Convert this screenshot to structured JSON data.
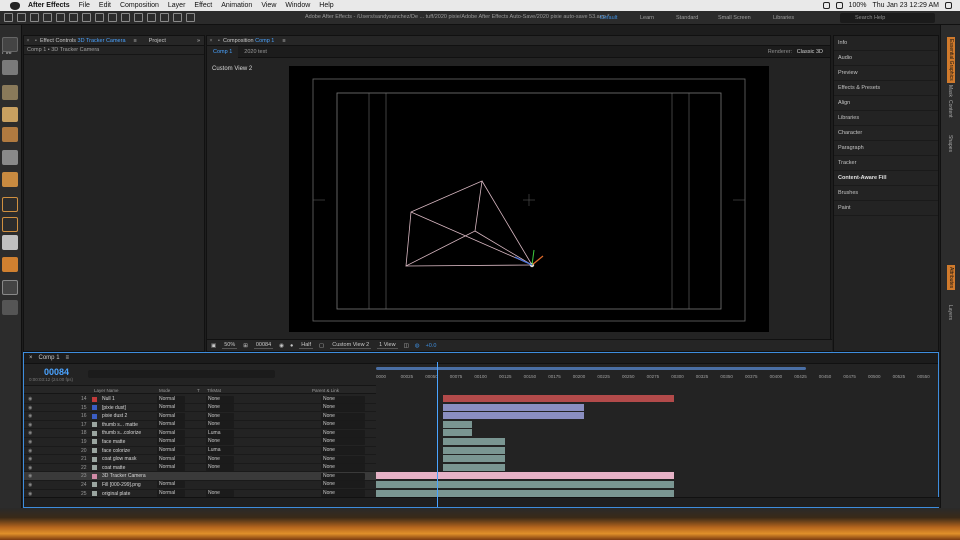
{
  "menubar": {
    "app": "After Effects",
    "items": [
      "File",
      "Edit",
      "Composition",
      "Layer",
      "Effect",
      "Animation",
      "View",
      "Window",
      "Help"
    ],
    "battery": "100%",
    "clock": "Thu Jan 23  12:29 AM"
  },
  "titlebar": {
    "path": "Adobe After Effects - /Users/sandysanchez/De ... tuff/2020 pixie/Adobe After Effects Auto-Save/2020 pixie auto-save 53.aep *",
    "workspaces": [
      "Default",
      "Learn",
      "Standard",
      "Small Screen",
      "Libraries"
    ],
    "search": "Search Help"
  },
  "left": {
    "file_tab": "File"
  },
  "effects_panel": {
    "tab": "Effect Controls",
    "tab_target": "3D Tracker Camera",
    "project_tab": "Project",
    "subhead": "Comp 1 • 3D Tracker Camera"
  },
  "composition_panel": {
    "tab": "Composition",
    "tab_target": "Comp 1",
    "subtabs": [
      "Comp 1",
      "2020 text"
    ],
    "renderer_label": "Renderer:",
    "renderer": "Classic 3D",
    "view_label": "Custom View 2",
    "bottom": {
      "zoom": "50%",
      "frame": "00084",
      "resolution": "Half",
      "view": "Custom View 2",
      "views": "1 View",
      "exposure": "+0.0"
    }
  },
  "right_panel": {
    "items": [
      "Info",
      "Audio",
      "Preview",
      "Effects & Presets",
      "Align",
      "Libraries",
      "Character",
      "Paragraph",
      "Tracker",
      "Content-Aware Fill",
      "Brushes",
      "Paint"
    ]
  },
  "right_strip": [
    "Essential Graphics",
    "Mask",
    "Content",
    "Shapes",
    "Attributes",
    "Layers"
  ],
  "timeline": {
    "tab": "Comp 1",
    "timecode": "00084",
    "timecode_sub": "0:00:03:12 (24.00 fps)",
    "columns": {
      "layer_name": "Layer Name",
      "mode": "Mode",
      "t": "T",
      "trkmat": "TrkMat",
      "parent": "Parent & Link"
    },
    "ruler": [
      "0000",
      "00025",
      "00050",
      "00075",
      "00100",
      "00125",
      "00150",
      "00175",
      "00200",
      "00225",
      "00250",
      "00275",
      "00300",
      "00325",
      "00350",
      "00375",
      "00400",
      "00425",
      "00450",
      "00475",
      "00500",
      "00525",
      "00550"
    ],
    "layers": [
      {
        "num": "14",
        "name": "Null 1",
        "color": "#c23b3b",
        "mode": "Normal",
        "trk": "None",
        "parent": "None"
      },
      {
        "num": "15",
        "name": "[pixie dust]",
        "color": "#3b5dc2",
        "mode": "Normal",
        "trk": "None",
        "parent": "None"
      },
      {
        "num": "16",
        "name": "pixie dust 2",
        "color": "#3b5dc2",
        "mode": "Normal",
        "trk": "None",
        "parent": "None"
      },
      {
        "num": "17",
        "name": "thumb s... matte",
        "color": "#9aa5a0",
        "mode": "Normal",
        "trk": "None",
        "parent": "None"
      },
      {
        "num": "18",
        "name": "thumb s...colorize",
        "color": "#9aa5a0",
        "mode": "Normal",
        "trk": "Luma",
        "parent": "None"
      },
      {
        "num": "19",
        "name": "face matte",
        "color": "#9aa5a0",
        "mode": "Normal",
        "trk": "None",
        "parent": "None"
      },
      {
        "num": "20",
        "name": "face colorize",
        "color": "#9aa5a0",
        "mode": "Normal",
        "trk": "Luma",
        "parent": "None"
      },
      {
        "num": "21",
        "name": "coat glow mask",
        "color": "#9aa5a0",
        "mode": "Normal",
        "trk": "None",
        "parent": "None"
      },
      {
        "num": "22",
        "name": "coat matte",
        "color": "#9aa5a0",
        "mode": "Normal",
        "trk": "None",
        "parent": "None"
      },
      {
        "num": "23",
        "name": "3D Tracker Camera",
        "color": "#d08aa6",
        "mode": "",
        "trk": "",
        "parent": "None"
      },
      {
        "num": "24",
        "name": "Fill [000-299].png",
        "color": "#9aa5a0",
        "mode": "Normal",
        "trk": "",
        "parent": "None"
      },
      {
        "num": "25",
        "name": "original plate",
        "color": "#9aa5a0",
        "mode": "Normal",
        "trk": "None",
        "parent": "None"
      }
    ]
  }
}
